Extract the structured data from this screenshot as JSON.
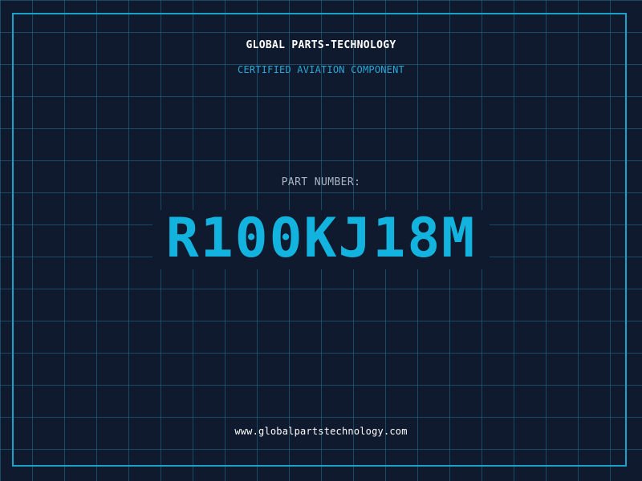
{
  "header": {
    "company_name": "GLOBAL PARTS-TECHNOLOGY",
    "subtitle": "CERTIFIED AVIATION COMPONENT"
  },
  "part": {
    "label": "PART NUMBER:",
    "number": "R100KJ18M"
  },
  "footer": {
    "website": "www.globalpartstechnology.com"
  },
  "colors": {
    "background": "#101a2e",
    "grid_line": "#28829f",
    "frame_border": "#1aa2c8",
    "accent_cyan": "#12b3de",
    "label_gray": "#a9b4c4",
    "text_white": "#ffffff"
  }
}
